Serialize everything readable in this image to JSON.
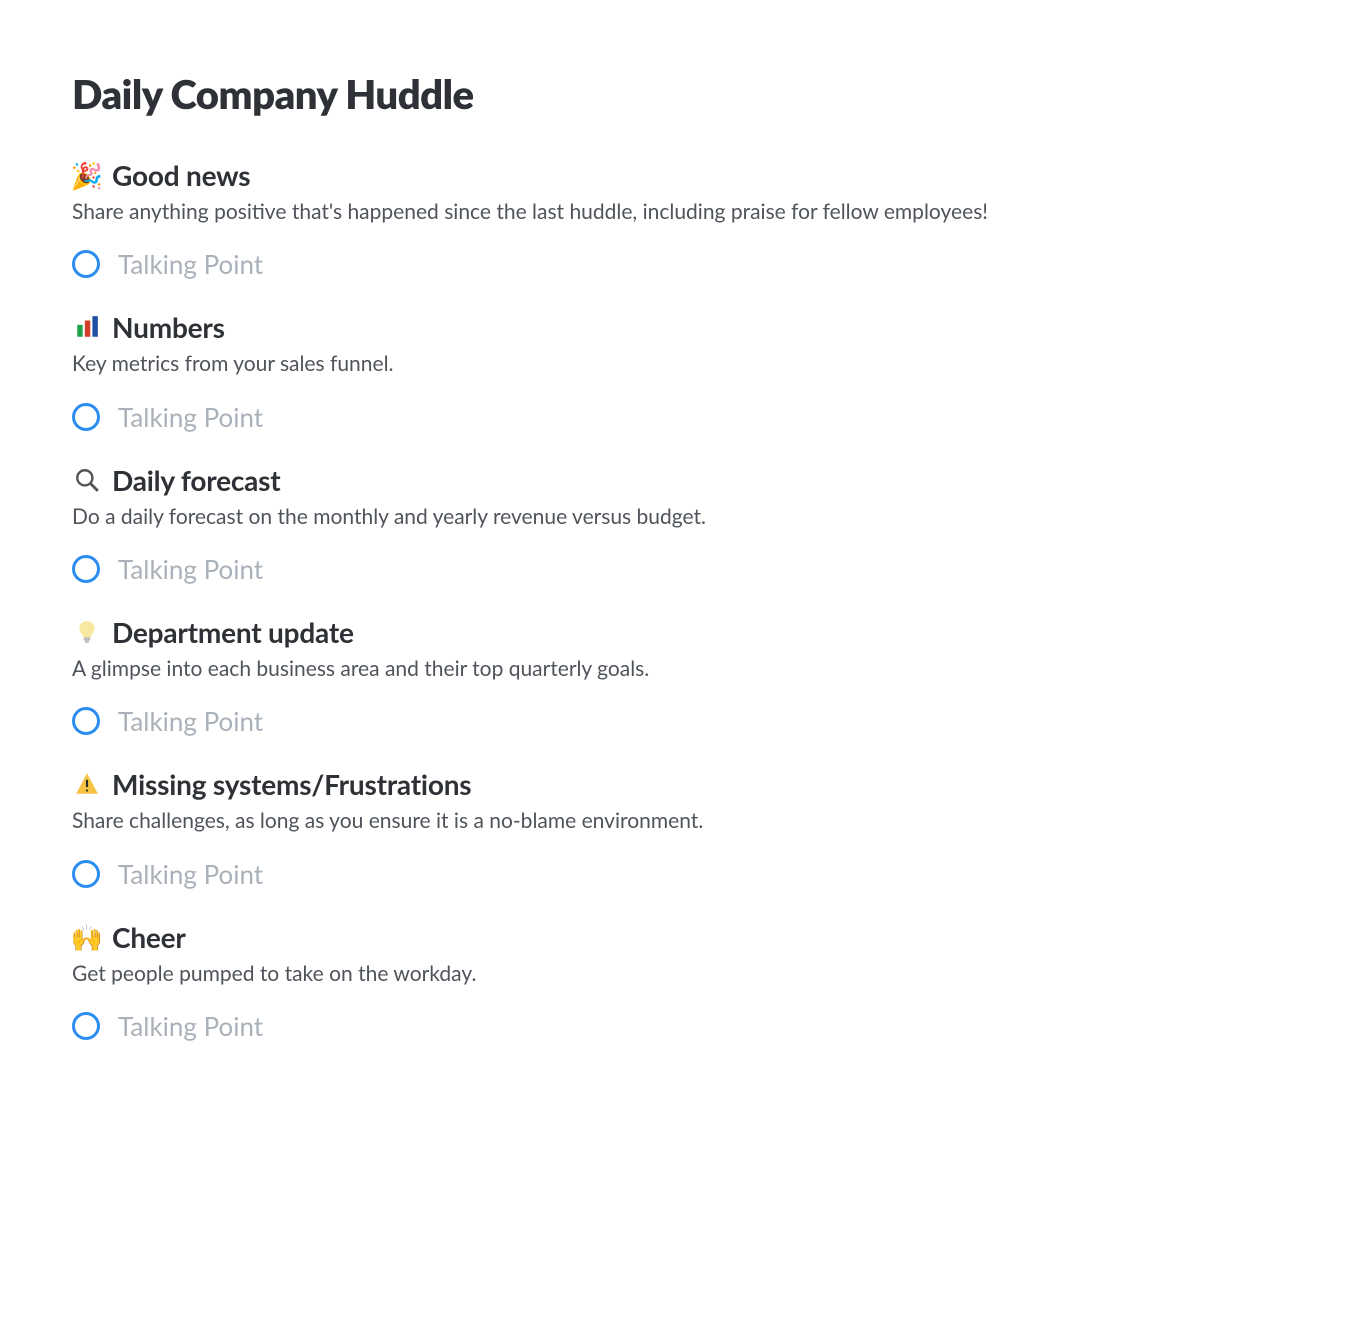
{
  "title": "Daily Company Huddle",
  "talking_placeholder": "Talking Point",
  "sections": [
    {
      "id": "good-news",
      "icon": "party-popper-icon",
      "emoji": "🎉",
      "title": "Good news",
      "desc": "Share anything positive that's happened since the last huddle, including praise for fellow employees!"
    },
    {
      "id": "numbers",
      "icon": "bar-chart-icon",
      "emoji": "",
      "title": "Numbers",
      "desc": "Key metrics from your sales funnel."
    },
    {
      "id": "daily-forecast",
      "icon": "magnifier-icon",
      "emoji": "",
      "title": "Daily forecast",
      "desc": "Do a daily forecast on the monthly and yearly revenue versus budget."
    },
    {
      "id": "department-update",
      "icon": "lightbulb-icon",
      "emoji": "",
      "title": "Department update",
      "desc": "A glimpse into each business area and their top quarterly goals."
    },
    {
      "id": "missing-systems",
      "icon": "warning-icon",
      "emoji": "",
      "title": "Missing systems/Frustrations",
      "desc": "Share challenges, as long as you ensure it is a no-blame environment."
    },
    {
      "id": "cheer",
      "icon": "raising-hands-icon",
      "emoji": "🙌",
      "title": "Cheer",
      "desc": "Get people pumped to take on the workday."
    }
  ]
}
